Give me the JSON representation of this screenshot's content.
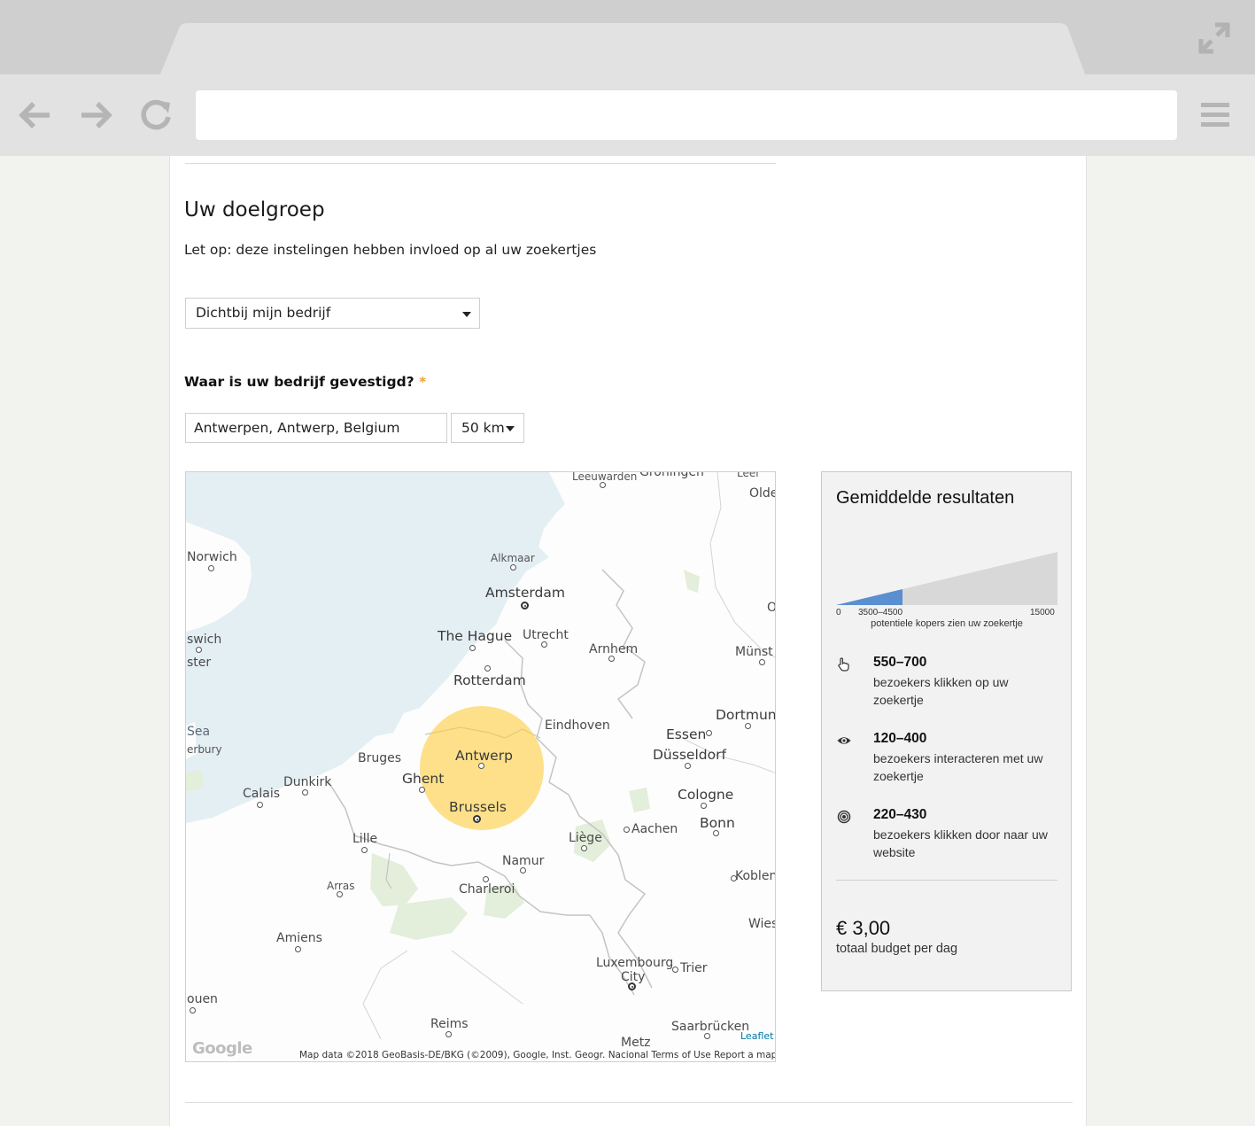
{
  "form": {
    "heading": "Uw doelgroep",
    "notice": "Let op: deze instelingen hebben invloed op al uw zoekertjes",
    "audience_select": "Dichtbij mijn bedrijf",
    "location_question": "Waar is uw bedrijf gevestigd?",
    "required_mark": "*",
    "location_value": "Antwerpen, Antwerp, Belgium",
    "radius_select": "50 km"
  },
  "map": {
    "labels": {
      "leeuwarden": "Leeuwarden",
      "groningen": "Groningen",
      "leer": "Leer",
      "olde": "Olde",
      "norwich": "Norwich",
      "alkmaar": "Alkmaar",
      "amsterdam": "Amsterdam",
      "o": "O",
      "ipswich": "swich",
      "colchester": "ster",
      "the_hague": "The Hague",
      "utrecht": "Utrecht",
      "arnhem": "Arnhem",
      "munster": "Münst",
      "rotterdam": "Rotterdam",
      "dortmund": "Dortmunc",
      "sea": "Sea",
      "canterbury": "erbury",
      "eindhoven": "Eindhoven",
      "essen": "Essen",
      "bruges": "Bruges",
      "antwerp": "Antwerp",
      "dusseldorf": "Düsseldorf",
      "ghent": "Ghent",
      "dunkirk": "Dunkirk",
      "calais": "Calais",
      "cologne": "Cologne",
      "brussels": "Brussels",
      "bonn": "Bonn",
      "aachen": "Aachen",
      "lille": "Lille",
      "liege": "Liège",
      "namur": "Namur",
      "koblenz": "Koblen",
      "arras": "Arras",
      "charleroi": "Charleroi",
      "wiesbaden": "Wies",
      "amiens": "Amiens",
      "luxembourg_1": "Luxembourg",
      "luxembourg_2": "City",
      "trier": "Trier",
      "rouen": "ouen",
      "reims": "Reims",
      "saarbrucken": "Saarbrücken",
      "metz": "Metz"
    },
    "google_logo": "Google",
    "leaflet": "Leaflet",
    "attribution": "Map data ©2018 GeoBasis-DE/BKG (©2009), Google, Inst. Geogr. Nacional   Terms of Use   Report a map error"
  },
  "results": {
    "title": "Gemiddelde resultaten",
    "gauge": {
      "min_label": "0",
      "range_label": "3500–4500",
      "max_label": "15000",
      "caption": "potentiele kopers zien uw zoekertje",
      "fill_start": 0,
      "fill_end": 4500,
      "max": 15000,
      "fill_color": "#5a8fd0",
      "track_color": "#d8d8d8"
    },
    "metrics": [
      {
        "icon": "hand-pointer-icon",
        "value": "550–700",
        "description": "bezoekers klikken op uw zoekertje"
      },
      {
        "icon": "eye-icon",
        "value": "120–400",
        "description": "bezoekers interacteren met uw zoekertje"
      },
      {
        "icon": "target-icon",
        "value": "220–430",
        "description": "bezoekers klikken door naar uw website"
      }
    ],
    "budget_value": "€ 3,00",
    "budget_label": "totaal budget per dag"
  }
}
